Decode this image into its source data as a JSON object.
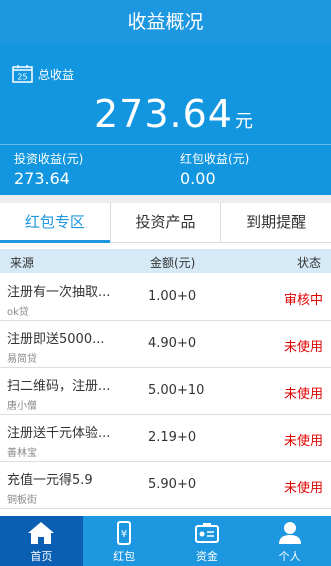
{
  "header": {
    "title": "收益概况"
  },
  "summary": {
    "calendar_day": "25",
    "total_label": "总收益",
    "total_amount": "273.64",
    "total_unit": "元",
    "invest_label": "投资收益(元)",
    "invest_value": "273.64",
    "redpack_label": "红包收益(元)",
    "redpack_value": "0.00"
  },
  "tabs": [
    {
      "label": "红包专区",
      "active": true
    },
    {
      "label": "投资产品",
      "active": false
    },
    {
      "label": "到期提醒",
      "active": false
    }
  ],
  "table": {
    "headers": {
      "source": "来源",
      "amount": "金额(元)",
      "status": "状态"
    },
    "rows": [
      {
        "title": "注册有一次抽取...",
        "platform": "ok贷",
        "amount": "1.00+0",
        "status": "审核中"
      },
      {
        "title": "注册即送5000...",
        "platform": "易简贷",
        "amount": "4.90+0",
        "status": "未使用"
      },
      {
        "title": "扫二维码，注册...",
        "platform": "唐小僧",
        "amount": "5.00+10",
        "status": "未使用"
      },
      {
        "title": "注册送千元体验...",
        "platform": "善林宝",
        "amount": "2.19+0",
        "status": "未使用"
      },
      {
        "title": "充值一元得5.9",
        "platform": "铜板街",
        "amount": "5.90+0",
        "status": "未使用"
      }
    ]
  },
  "tabbar": [
    {
      "label": "首页",
      "icon": "home-icon",
      "active": true
    },
    {
      "label": "红包",
      "icon": "phone-redpack-icon",
      "active": false
    },
    {
      "label": "资金",
      "icon": "wallet-icon",
      "active": false
    },
    {
      "label": "个人",
      "icon": "person-icon",
      "active": false
    }
  ],
  "colors": {
    "primary": "#1c97e0",
    "status_red": "#e00000",
    "tab_active_bg": "#0a5fb3"
  }
}
